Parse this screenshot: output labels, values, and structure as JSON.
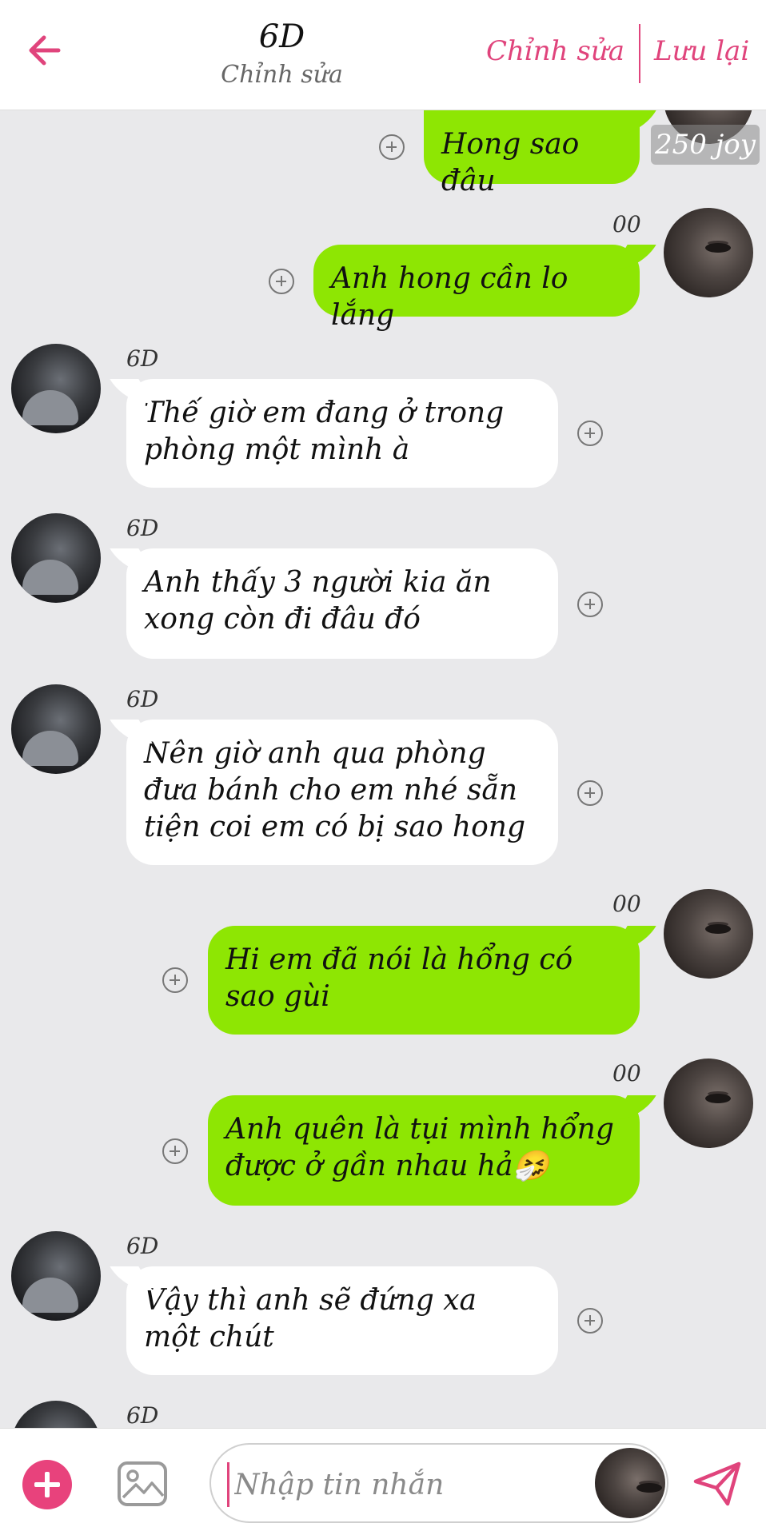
{
  "header": {
    "title": "6D",
    "subtitle": "Chỉnh sửa",
    "edit_label": "Chỉnh sửa",
    "save_label": "Lưu lại",
    "accent_color": "#e0447c"
  },
  "chat": {
    "joy_badge": "250 joy",
    "messages": [
      {
        "side": "right",
        "sender": "",
        "text": "Hong sao đâu"
      },
      {
        "side": "right",
        "sender": "00",
        "text": "Anh hong cần lo lắng"
      },
      {
        "side": "left",
        "sender": "6D",
        "text": "Thế giờ em đang ở trong phòng một mình à"
      },
      {
        "side": "left",
        "sender": "6D",
        "text": "Anh thấy 3 người kia ăn xong còn đi đâu đó"
      },
      {
        "side": "left",
        "sender": "6D",
        "text": "Nên giờ anh qua phòng đưa bánh cho em nhé sẵn tiện coi em có bị sao hong"
      },
      {
        "side": "right",
        "sender": "00",
        "text": "Hi em đã nói là hổng có sao gùi"
      },
      {
        "side": "right",
        "sender": "00",
        "text": "Anh quên là tụi mình hổng được ở gần nhau hả🤧"
      },
      {
        "side": "left",
        "sender": "6D",
        "text": "Vậy thì anh sẽ đứng xa một chút"
      },
      {
        "side": "left",
        "sender": "6D",
        "text": ""
      }
    ]
  },
  "composer": {
    "placeholder": "Nhập tin nhắn"
  },
  "colors": {
    "outgoing_bubble": "#8ee603",
    "incoming_bubble": "#ffffff",
    "background": "#e9e9eb",
    "add_button": "#e8427c"
  }
}
